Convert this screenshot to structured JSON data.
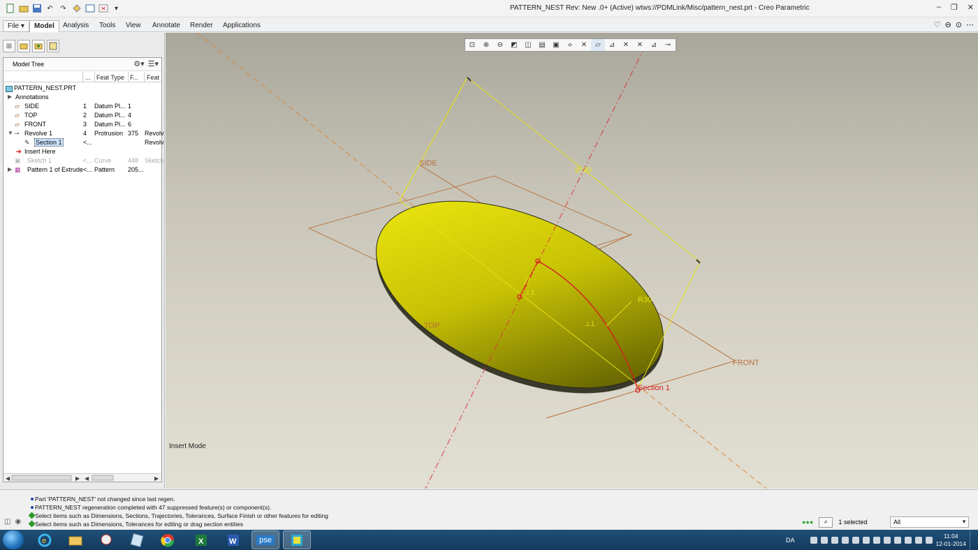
{
  "window": {
    "title": "PATTERN_NEST Rev: New .0+  (Active) wtws://PDMLink/Misc/pattern_nest.prt - Creo Parametric",
    "controls": [
      "–",
      "❐",
      "✕"
    ]
  },
  "quick_access": [
    "new-icon",
    "open-icon",
    "save-icon",
    "undo-icon",
    "redo-icon",
    "regenerate-icon",
    "windows-icon",
    "close-icon"
  ],
  "ribbon": {
    "tabs": [
      "File ▾",
      "Model",
      "Analysis",
      "Tools",
      "View",
      "Annotate",
      "Render",
      "Applications"
    ],
    "active_tab": "Model"
  },
  "model_tree": {
    "title": "Model Tree",
    "columns": [
      "...",
      "Feat Type",
      "F...",
      "Feat"
    ],
    "rows": [
      {
        "name": "PATTERN_NEST.PRT",
        "num": "",
        "type": "",
        "fid": "",
        "feat": ""
      },
      {
        "name": "Annotations",
        "num": "",
        "type": "",
        "fid": "",
        "feat": ""
      },
      {
        "name": "SIDE",
        "num": "1",
        "type": "Datum Pl...",
        "fid": "1",
        "feat": ""
      },
      {
        "name": "TOP",
        "num": "2",
        "type": "Datum Pl...",
        "fid": "4",
        "feat": ""
      },
      {
        "name": "FRONT",
        "num": "3",
        "type": "Datum Pl...",
        "fid": "6",
        "feat": ""
      },
      {
        "name": "Revolve 1",
        "num": "4",
        "type": "Protrusion",
        "fid": "375",
        "feat": "Revolv"
      },
      {
        "name": "Section 1",
        "num": "<...",
        "type": "",
        "fid": "",
        "feat": "Revolv"
      },
      {
        "name": "Insert Here",
        "num": "",
        "type": "",
        "fid": "",
        "feat": ""
      },
      {
        "name": "Sketch 1",
        "num": "<...",
        "type": "Curve",
        "fid": "448",
        "feat": "Sketch"
      },
      {
        "name": "Pattern 1 of Extrude",
        "num": "<...",
        "type": "Pattern",
        "fid": "205...",
        "feat": ""
      }
    ]
  },
  "viewport": {
    "labels": {
      "side": "SIDE",
      "top": "TOP",
      "front": "FRONT",
      "section": "Section 1",
      "diameter": "Ø 30",
      "radius": "R30"
    },
    "mode_text": "Insert Mode",
    "view_toolbar": [
      "refit-icon",
      "zoom-in-icon",
      "zoom-out-icon",
      "repaint-icon",
      "reorient-icon",
      "saved-views-icon",
      "display-style-icon",
      "datum-planes-icon",
      "datum-axes-icon",
      "datum-points-icon",
      "coord-sys-icon",
      "annotations-icon",
      "spin-center-icon",
      "csys-display-icon",
      "plane-tags-icon",
      "point-tags-icon"
    ]
  },
  "messages": [
    {
      "kind": "info",
      "text": "Part 'PATTERN_NEST' not changed since last regen."
    },
    {
      "kind": "info",
      "text": "PATTERN_NEST regeneration completed with 47 suppressed feature(s) or component(s)."
    },
    {
      "kind": "prompt",
      "text": "Select items such as Dimensions, Sections, Trajectories, Tolerances, Surface Finish or other features for editing"
    },
    {
      "kind": "prompt",
      "text": "Select items such as Dimensions, Tolerances for editing or drag section entities"
    }
  ],
  "status": {
    "selected": "1 selected",
    "filter": "All"
  },
  "taskbar": {
    "apps": [
      "ie-icon",
      "explorer-icon",
      "paint-icon",
      "notes-icon",
      "chrome-icon",
      "excel-icon",
      "word-icon",
      "pse-app",
      "creo-icon"
    ],
    "pse_label": "pse",
    "tray_lang": "DA",
    "time": "11:04",
    "date": "12-01-2014"
  },
  "colors": {
    "accent_yellow": "#e5e016",
    "datum_orange": "#b86f3a",
    "axis_red": "#d93a3a",
    "selection_red": "#d41f1f"
  }
}
